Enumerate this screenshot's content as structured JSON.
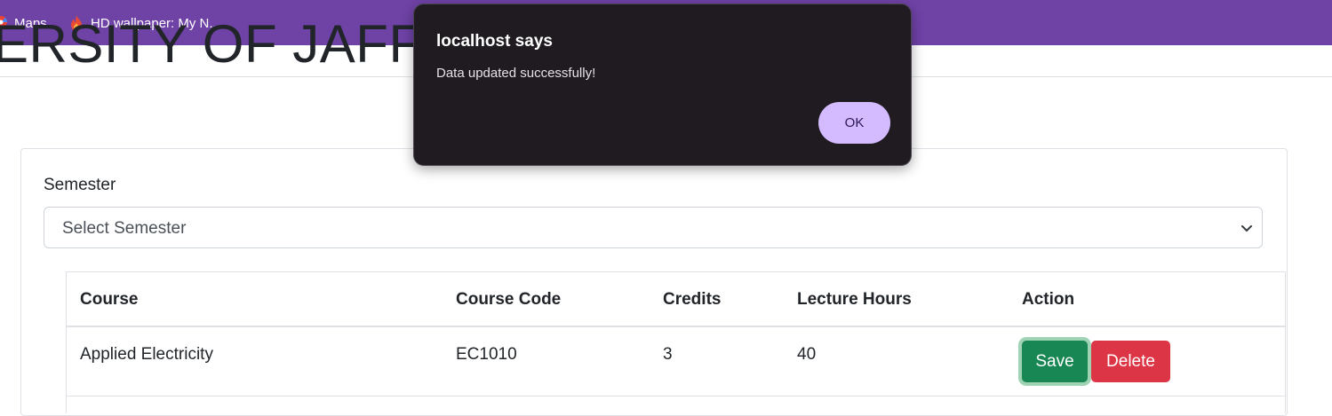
{
  "bookmarks": [
    {
      "label": "Maps",
      "icon": "maps-icon"
    },
    {
      "label": "HD wallpaper: My N...",
      "icon": "flame-icon"
    }
  ],
  "page": {
    "heading": "ERSITY OF JAFFNA"
  },
  "form": {
    "semester_label": "Semester",
    "semester_select_value": "Select Semester"
  },
  "table": {
    "headers": [
      "Course",
      "Course Code",
      "Credits",
      "Lecture Hours",
      "Action"
    ],
    "rows": [
      {
        "course": "Applied Electricity",
        "code": "EC1010",
        "credits": "3",
        "hours": "40"
      }
    ],
    "save_label": "Save",
    "delete_label": "Delete"
  },
  "dialog": {
    "title": "localhost says",
    "message": "Data updated successfully!",
    "ok_label": "OK"
  },
  "colors": {
    "bookmarks_bar": "#6f42a6",
    "save_button": "#198754",
    "delete_button": "#dc3545",
    "dialog_bg": "#1f1b21",
    "ok_button": "#d4bbff"
  }
}
